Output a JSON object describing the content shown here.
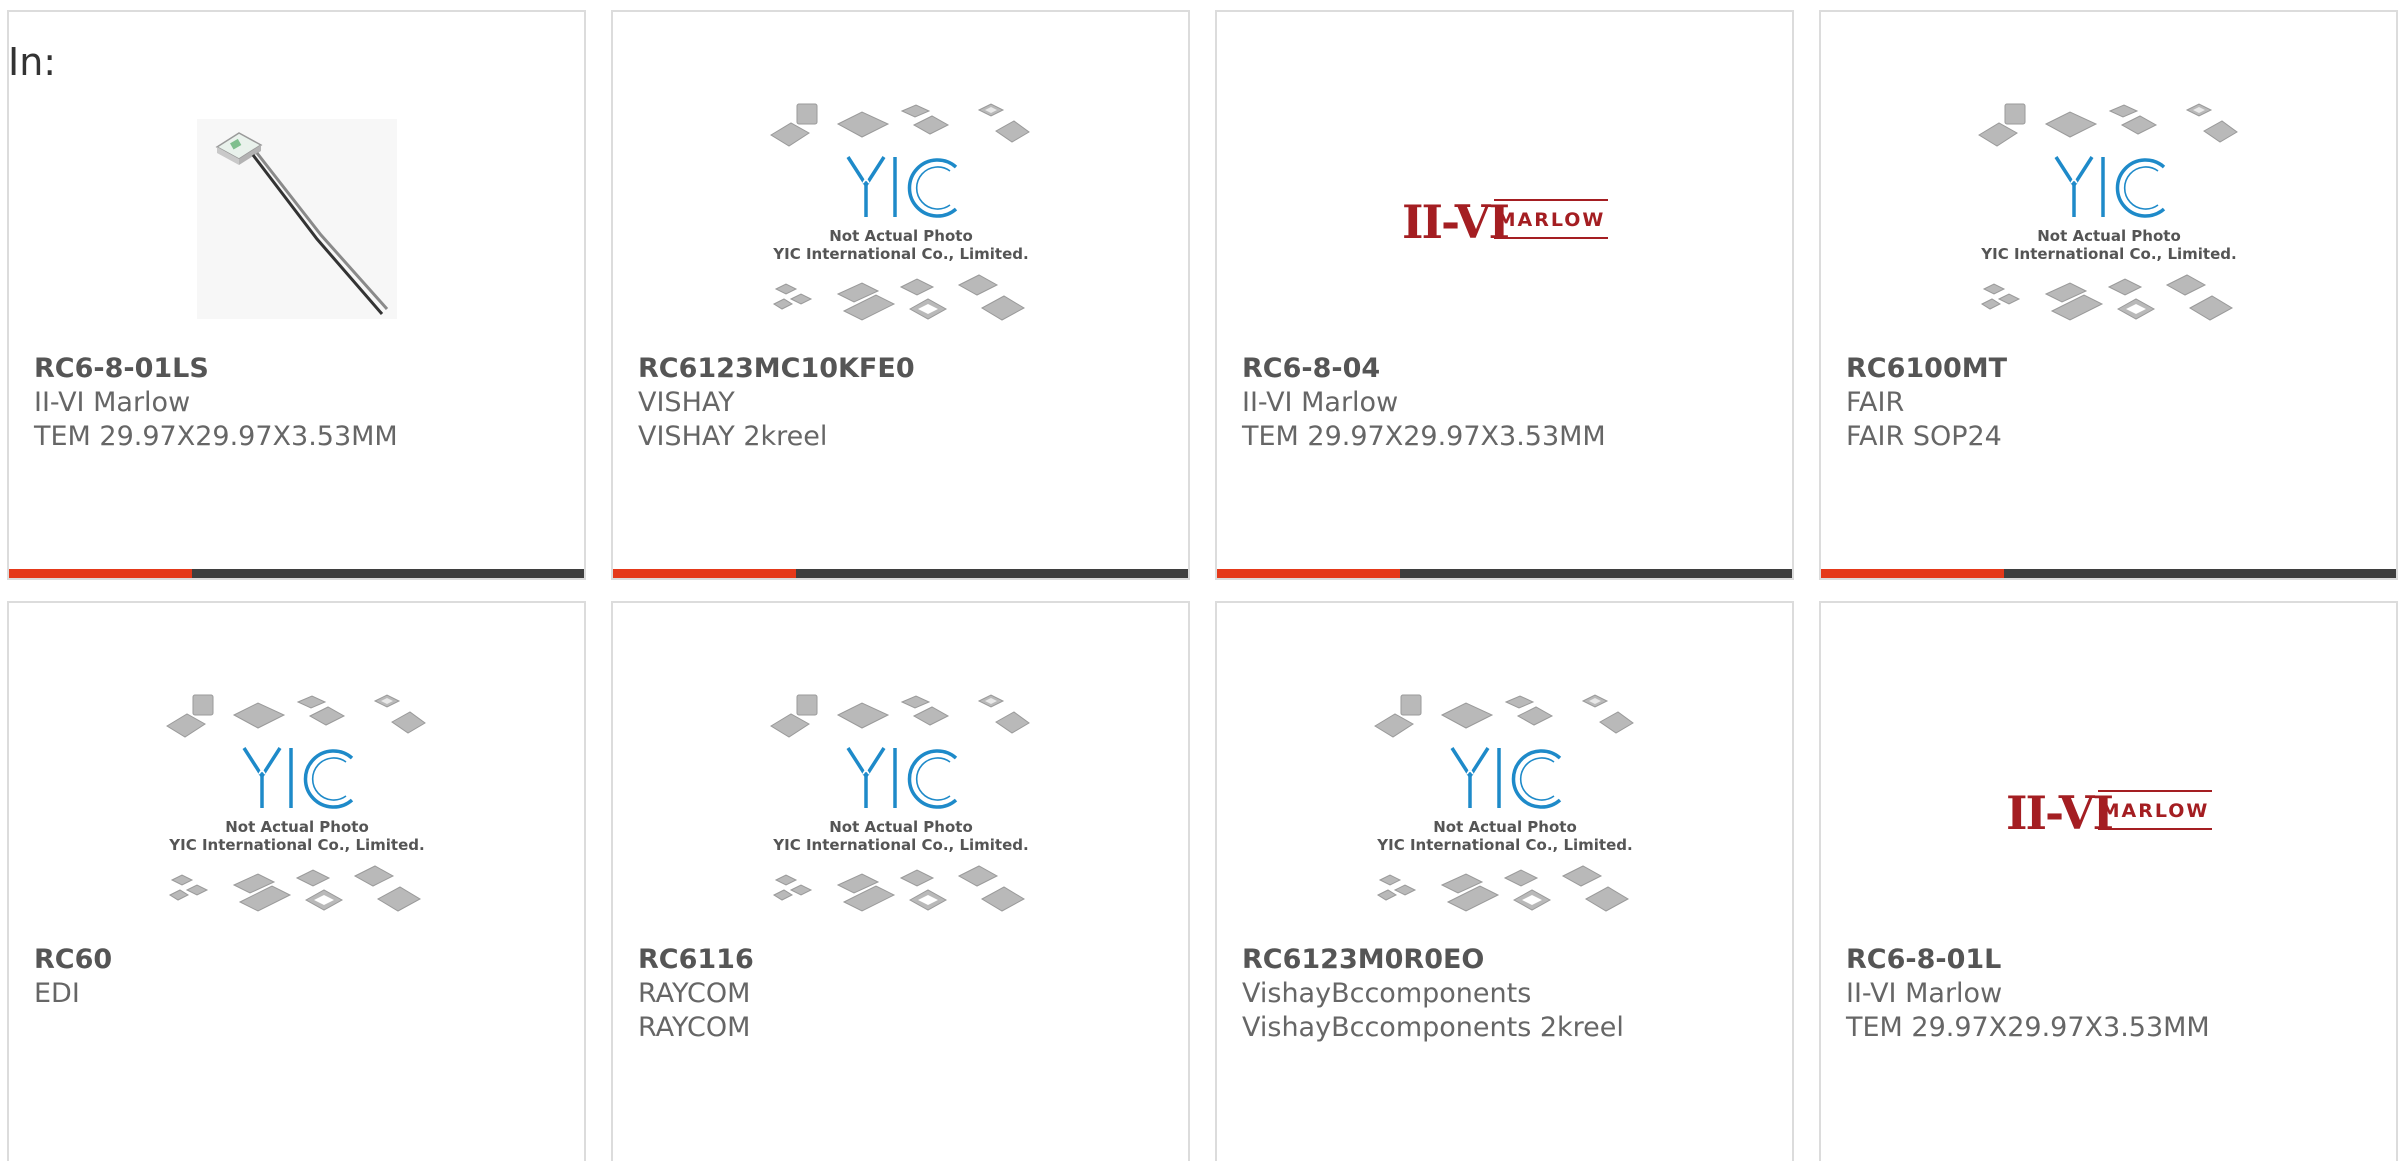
{
  "header": {
    "in_label": "In:"
  },
  "colors": {
    "accent": "#e5391a",
    "bar_dark": "#3f3f3f",
    "card_border": "#dcdcdc",
    "yic_blue": "#1e8ac9",
    "marlow_red": "#a41e22"
  },
  "placeholder": {
    "caption_line1": "Not Actual Photo",
    "caption_line2": "YIC International Co., Limited.",
    "logo_text": "YIC"
  },
  "marlow_logo": {
    "mark": "II-VI",
    "word": "MARLOW"
  },
  "products": [
    {
      "part": "RC6-8-01LS",
      "maker": "II-VI Marlow",
      "desc": "TEM 29.97X29.97X3.53MM",
      "image": "tec-module-photo"
    },
    {
      "part": "RC6123MC10KFE0",
      "maker": "VISHAY",
      "desc": "VISHAY 2kreel",
      "image": "yic-placeholder"
    },
    {
      "part": "RC6-8-04",
      "maker": "II-VI Marlow",
      "desc": "TEM 29.97X29.97X3.53MM",
      "image": "marlow-logo"
    },
    {
      "part": "RC6100MT",
      "maker": "FAIR",
      "desc": "FAIR SOP24",
      "image": "yic-placeholder"
    },
    {
      "part": "RC60",
      "maker": "EDI",
      "desc": "",
      "image": "yic-placeholder"
    },
    {
      "part": "RC6116",
      "maker": "RAYCOM",
      "desc": "RAYCOM",
      "image": "yic-placeholder"
    },
    {
      "part": "RC6123M0R0EO",
      "maker": "VishayBccomponents",
      "desc": "VishayBccomponents 2kreel",
      "image": "yic-placeholder"
    },
    {
      "part": "RC6-8-01L",
      "maker": "II-VI Marlow",
      "desc": "TEM 29.97X29.97X3.53MM",
      "image": "marlow-logo"
    }
  ]
}
